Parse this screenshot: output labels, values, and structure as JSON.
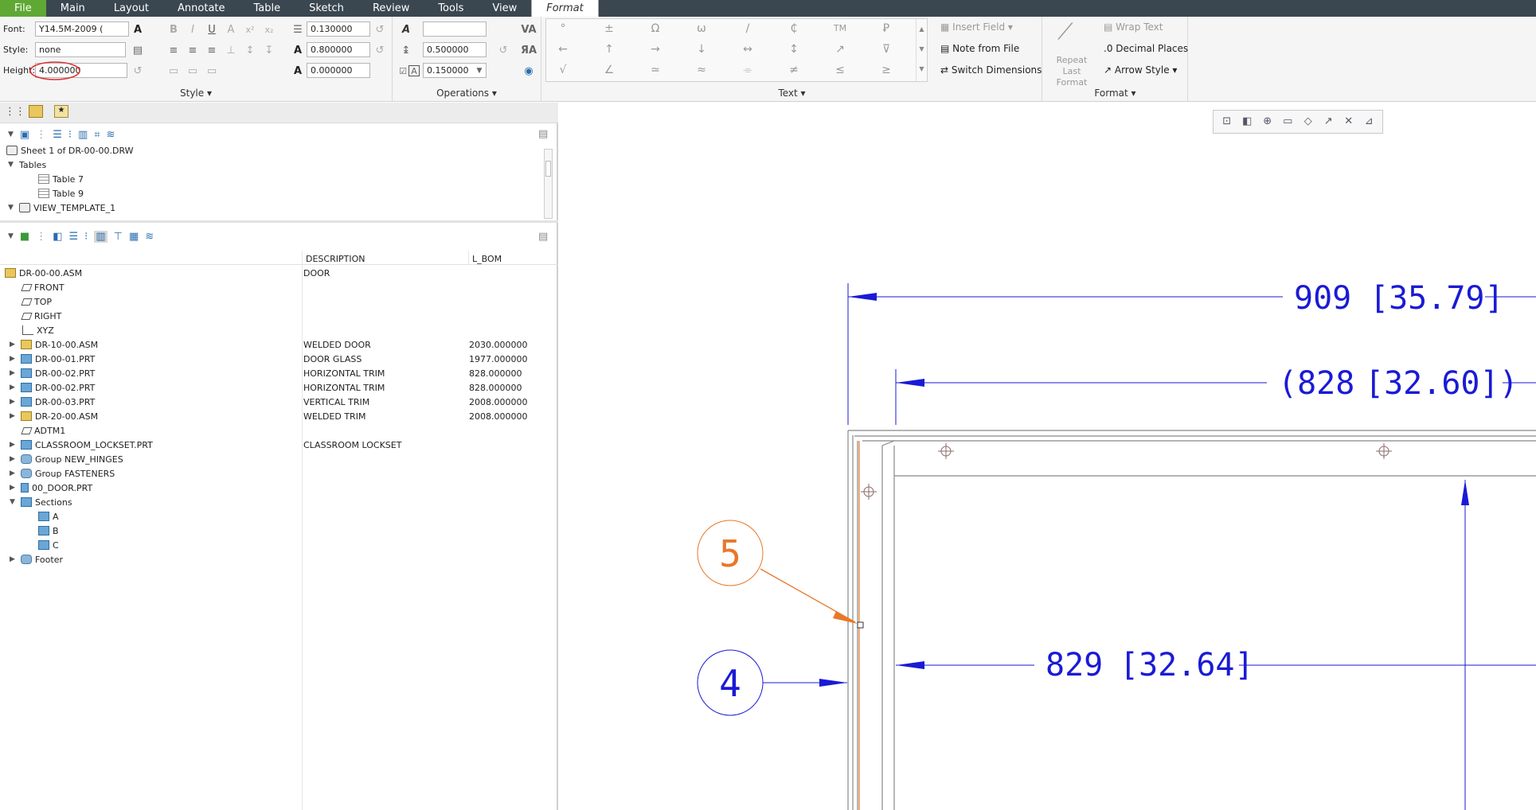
{
  "menu": {
    "items": [
      "File",
      "Main",
      "Layout",
      "Annotate",
      "Table",
      "Sketch",
      "Review",
      "Tools",
      "View",
      "Format"
    ],
    "active": "Format"
  },
  "style_group": {
    "label": "Style",
    "font_label": "Font:",
    "font_value": "Y14.5M-2009 (",
    "style_label": "Style:",
    "style_value": "none",
    "height_label": "Height:",
    "height_value": "4.000000",
    "values": [
      "0.130000",
      "0.800000",
      "0.000000"
    ]
  },
  "operations_group": {
    "label": "Operations",
    "value_blank": "",
    "line_spacing": "0.500000",
    "char_spacing": "0.150000"
  },
  "text_group": {
    "label": "Text",
    "symbols": [
      "°",
      "±",
      "Ω",
      "ω",
      "/",
      "₵",
      "TM",
      "Ꝑ",
      "←",
      "↑",
      "→",
      "↓",
      "↔",
      "↕",
      "↗",
      "⊽",
      "√",
      "∠",
      "≃",
      "≈",
      "⌯",
      "≠",
      "≤",
      "≥"
    ],
    "insert_field": "Insert Field",
    "note_from_file": "Note from File",
    "switch_dimensions": "Switch Dimensions"
  },
  "format_group": {
    "label": "Format",
    "repeat_last": "Repeat Last Format",
    "wrap_text": "Wrap Text",
    "decimal_places": "Decimal Places",
    "arrow_style": "Arrow Style"
  },
  "layer_tree": {
    "items": [
      {
        "label": "Sheet 1 of DR-00-00.DRW"
      },
      {
        "label": "Tables"
      },
      {
        "label": "Table 7"
      },
      {
        "label": "Table 9"
      },
      {
        "label": "VIEW_TEMPLATE_1"
      }
    ]
  },
  "model_tree": {
    "headers": [
      "DESCRIPTION",
      "L_BOM"
    ],
    "rows": [
      {
        "name": "DR-00-00.ASM",
        "desc": "DOOR",
        "bom": ""
      },
      {
        "name": "FRONT",
        "desc": "",
        "bom": ""
      },
      {
        "name": "TOP",
        "desc": "",
        "bom": ""
      },
      {
        "name": "RIGHT",
        "desc": "",
        "bom": ""
      },
      {
        "name": "XYZ",
        "desc": "",
        "bom": ""
      },
      {
        "name": "DR-10-00.ASM",
        "desc": "WELDED DOOR",
        "bom": "2030.000000"
      },
      {
        "name": "DR-00-01.PRT",
        "desc": "DOOR GLASS",
        "bom": "1977.000000"
      },
      {
        "name": "DR-00-02.PRT",
        "desc": "HORIZONTAL TRIM",
        "bom": "828.000000"
      },
      {
        "name": "DR-00-02.PRT",
        "desc": "HORIZONTAL TRIM",
        "bom": "828.000000"
      },
      {
        "name": "DR-00-03.PRT",
        "desc": "VERTICAL TRIM",
        "bom": "2008.000000"
      },
      {
        "name": "DR-20-00.ASM",
        "desc": "WELDED TRIM",
        "bom": "2008.000000"
      },
      {
        "name": "ADTM1",
        "desc": "",
        "bom": ""
      },
      {
        "name": "CLASSROOM_LOCKSET.PRT",
        "desc": "CLASSROOM LOCKSET",
        "bom": ""
      },
      {
        "name": "Group NEW_HINGES",
        "desc": "",
        "bom": ""
      },
      {
        "name": "Group FASTENERS",
        "desc": "",
        "bom": ""
      },
      {
        "name": "00_DOOR.PRT",
        "desc": "",
        "bom": ""
      },
      {
        "name": "Sections",
        "desc": "",
        "bom": ""
      },
      {
        "name": "A",
        "desc": "",
        "bom": ""
      },
      {
        "name": "B",
        "desc": "",
        "bom": ""
      },
      {
        "name": "C",
        "desc": "",
        "bom": ""
      },
      {
        "name": "Footer",
        "desc": "",
        "bom": ""
      }
    ]
  },
  "drawing": {
    "dim1": "909",
    "dim1_alt": "[35.79]",
    "dim2": "(828",
    "dim2_alt": "[32.60])",
    "dim3": "829",
    "dim3_alt": "[32.64]",
    "balloon_orange": "5",
    "balloon_blue": "4"
  },
  "colors": {
    "menubar": "#3a4650",
    "file_tab": "#5fa834",
    "dim_blue": "#1a1ad6",
    "balloon_orange": "#e8782a"
  }
}
